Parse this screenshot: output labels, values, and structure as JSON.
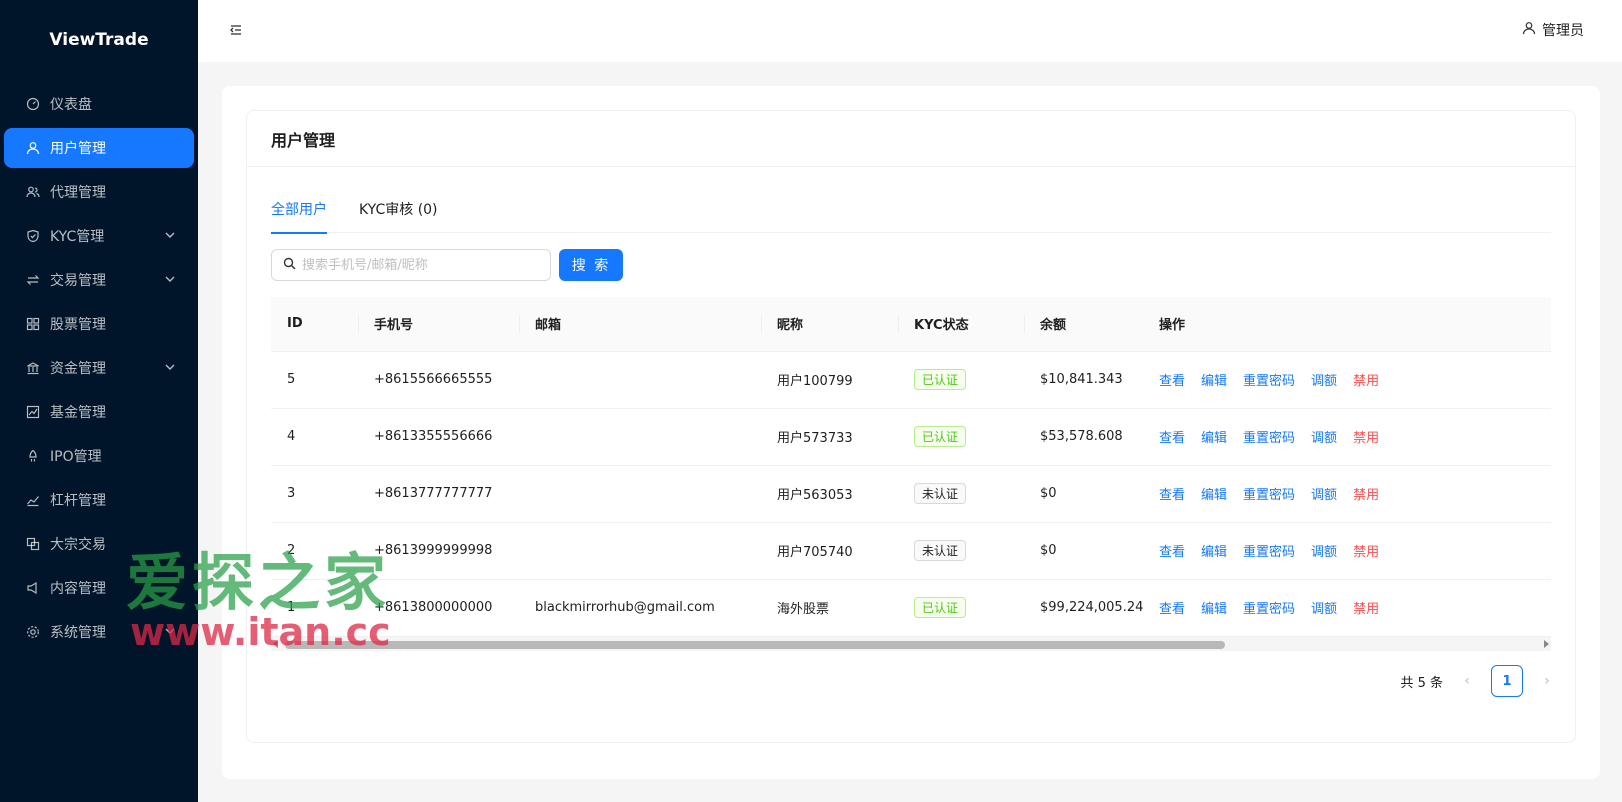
{
  "app": {
    "logo": "ViewTrade"
  },
  "sidebar": {
    "items": [
      {
        "label": "仪表盘",
        "icon": "dashboard-icon",
        "active": false,
        "has_children": false
      },
      {
        "label": "用户管理",
        "icon": "user-icon",
        "active": true,
        "has_children": false
      },
      {
        "label": "代理管理",
        "icon": "team-icon",
        "active": false,
        "has_children": false
      },
      {
        "label": "KYC管理",
        "icon": "shield-icon",
        "active": false,
        "has_children": true
      },
      {
        "label": "交易管理",
        "icon": "swap-icon",
        "active": false,
        "has_children": true
      },
      {
        "label": "股票管理",
        "icon": "appstore-icon",
        "active": false,
        "has_children": false
      },
      {
        "label": "资金管理",
        "icon": "bank-icon",
        "active": false,
        "has_children": true
      },
      {
        "label": "基金管理",
        "icon": "fund-icon",
        "active": false,
        "has_children": false
      },
      {
        "label": "IPO管理",
        "icon": "rocket-icon",
        "active": false,
        "has_children": false
      },
      {
        "label": "杠杆管理",
        "icon": "stock-icon",
        "active": false,
        "has_children": false
      },
      {
        "label": "大宗交易",
        "icon": "block-icon",
        "active": false,
        "has_children": false
      },
      {
        "label": "内容管理",
        "icon": "notification-icon",
        "active": false,
        "has_children": false
      },
      {
        "label": "系统管理",
        "icon": "setting-icon",
        "active": false,
        "has_children": true
      }
    ]
  },
  "header": {
    "user_label": "管理员"
  },
  "page": {
    "title": "用户管理",
    "tabs": [
      {
        "label": "全部用户",
        "active": true
      },
      {
        "label": "KYC审核 (0)",
        "active": false
      }
    ],
    "search": {
      "placeholder": "搜索手机号/邮箱/昵称",
      "value": "",
      "button_label": "搜 索"
    }
  },
  "table": {
    "columns": [
      "ID",
      "手机号",
      "邮箱",
      "昵称",
      "KYC状态",
      "余额",
      "操作"
    ],
    "rows": [
      {
        "id": "5",
        "phone": "+8615566665555",
        "email": "",
        "nickname": "用户100799",
        "kyc": "已认证",
        "kyc_ok": true,
        "balance": "$10,841.343"
      },
      {
        "id": "4",
        "phone": "+8613355556666",
        "email": "",
        "nickname": "用户573733",
        "kyc": "已认证",
        "kyc_ok": true,
        "balance": "$53,578.608"
      },
      {
        "id": "3",
        "phone": "+8613777777777",
        "email": "",
        "nickname": "用户563053",
        "kyc": "未认证",
        "kyc_ok": false,
        "balance": "$0"
      },
      {
        "id": "2",
        "phone": "+8613999999998",
        "email": "",
        "nickname": "用户705740",
        "kyc": "未认证",
        "kyc_ok": false,
        "balance": "$0"
      },
      {
        "id": "1",
        "phone": "+8613800000000",
        "email": "blackmirrorhub@gmail.com",
        "nickname": "海外股票",
        "kyc": "已认证",
        "kyc_ok": true,
        "balance": "$99,224,005.243"
      }
    ],
    "actions": [
      {
        "label": "查看",
        "danger": false
      },
      {
        "label": "编辑",
        "danger": false
      },
      {
        "label": "重置密码",
        "danger": false
      },
      {
        "label": "调额",
        "danger": false
      },
      {
        "label": "禁用",
        "danger": true
      }
    ]
  },
  "pagination": {
    "total_text": "共 5 条",
    "current_page": "1"
  },
  "watermark": {
    "text": "爱探之家",
    "url": "www.itan.cc"
  },
  "colors": {
    "primary": "#1677ff",
    "sidebar_bg": "#001529",
    "success": "#52c41a",
    "danger": "#ff4d4f"
  }
}
